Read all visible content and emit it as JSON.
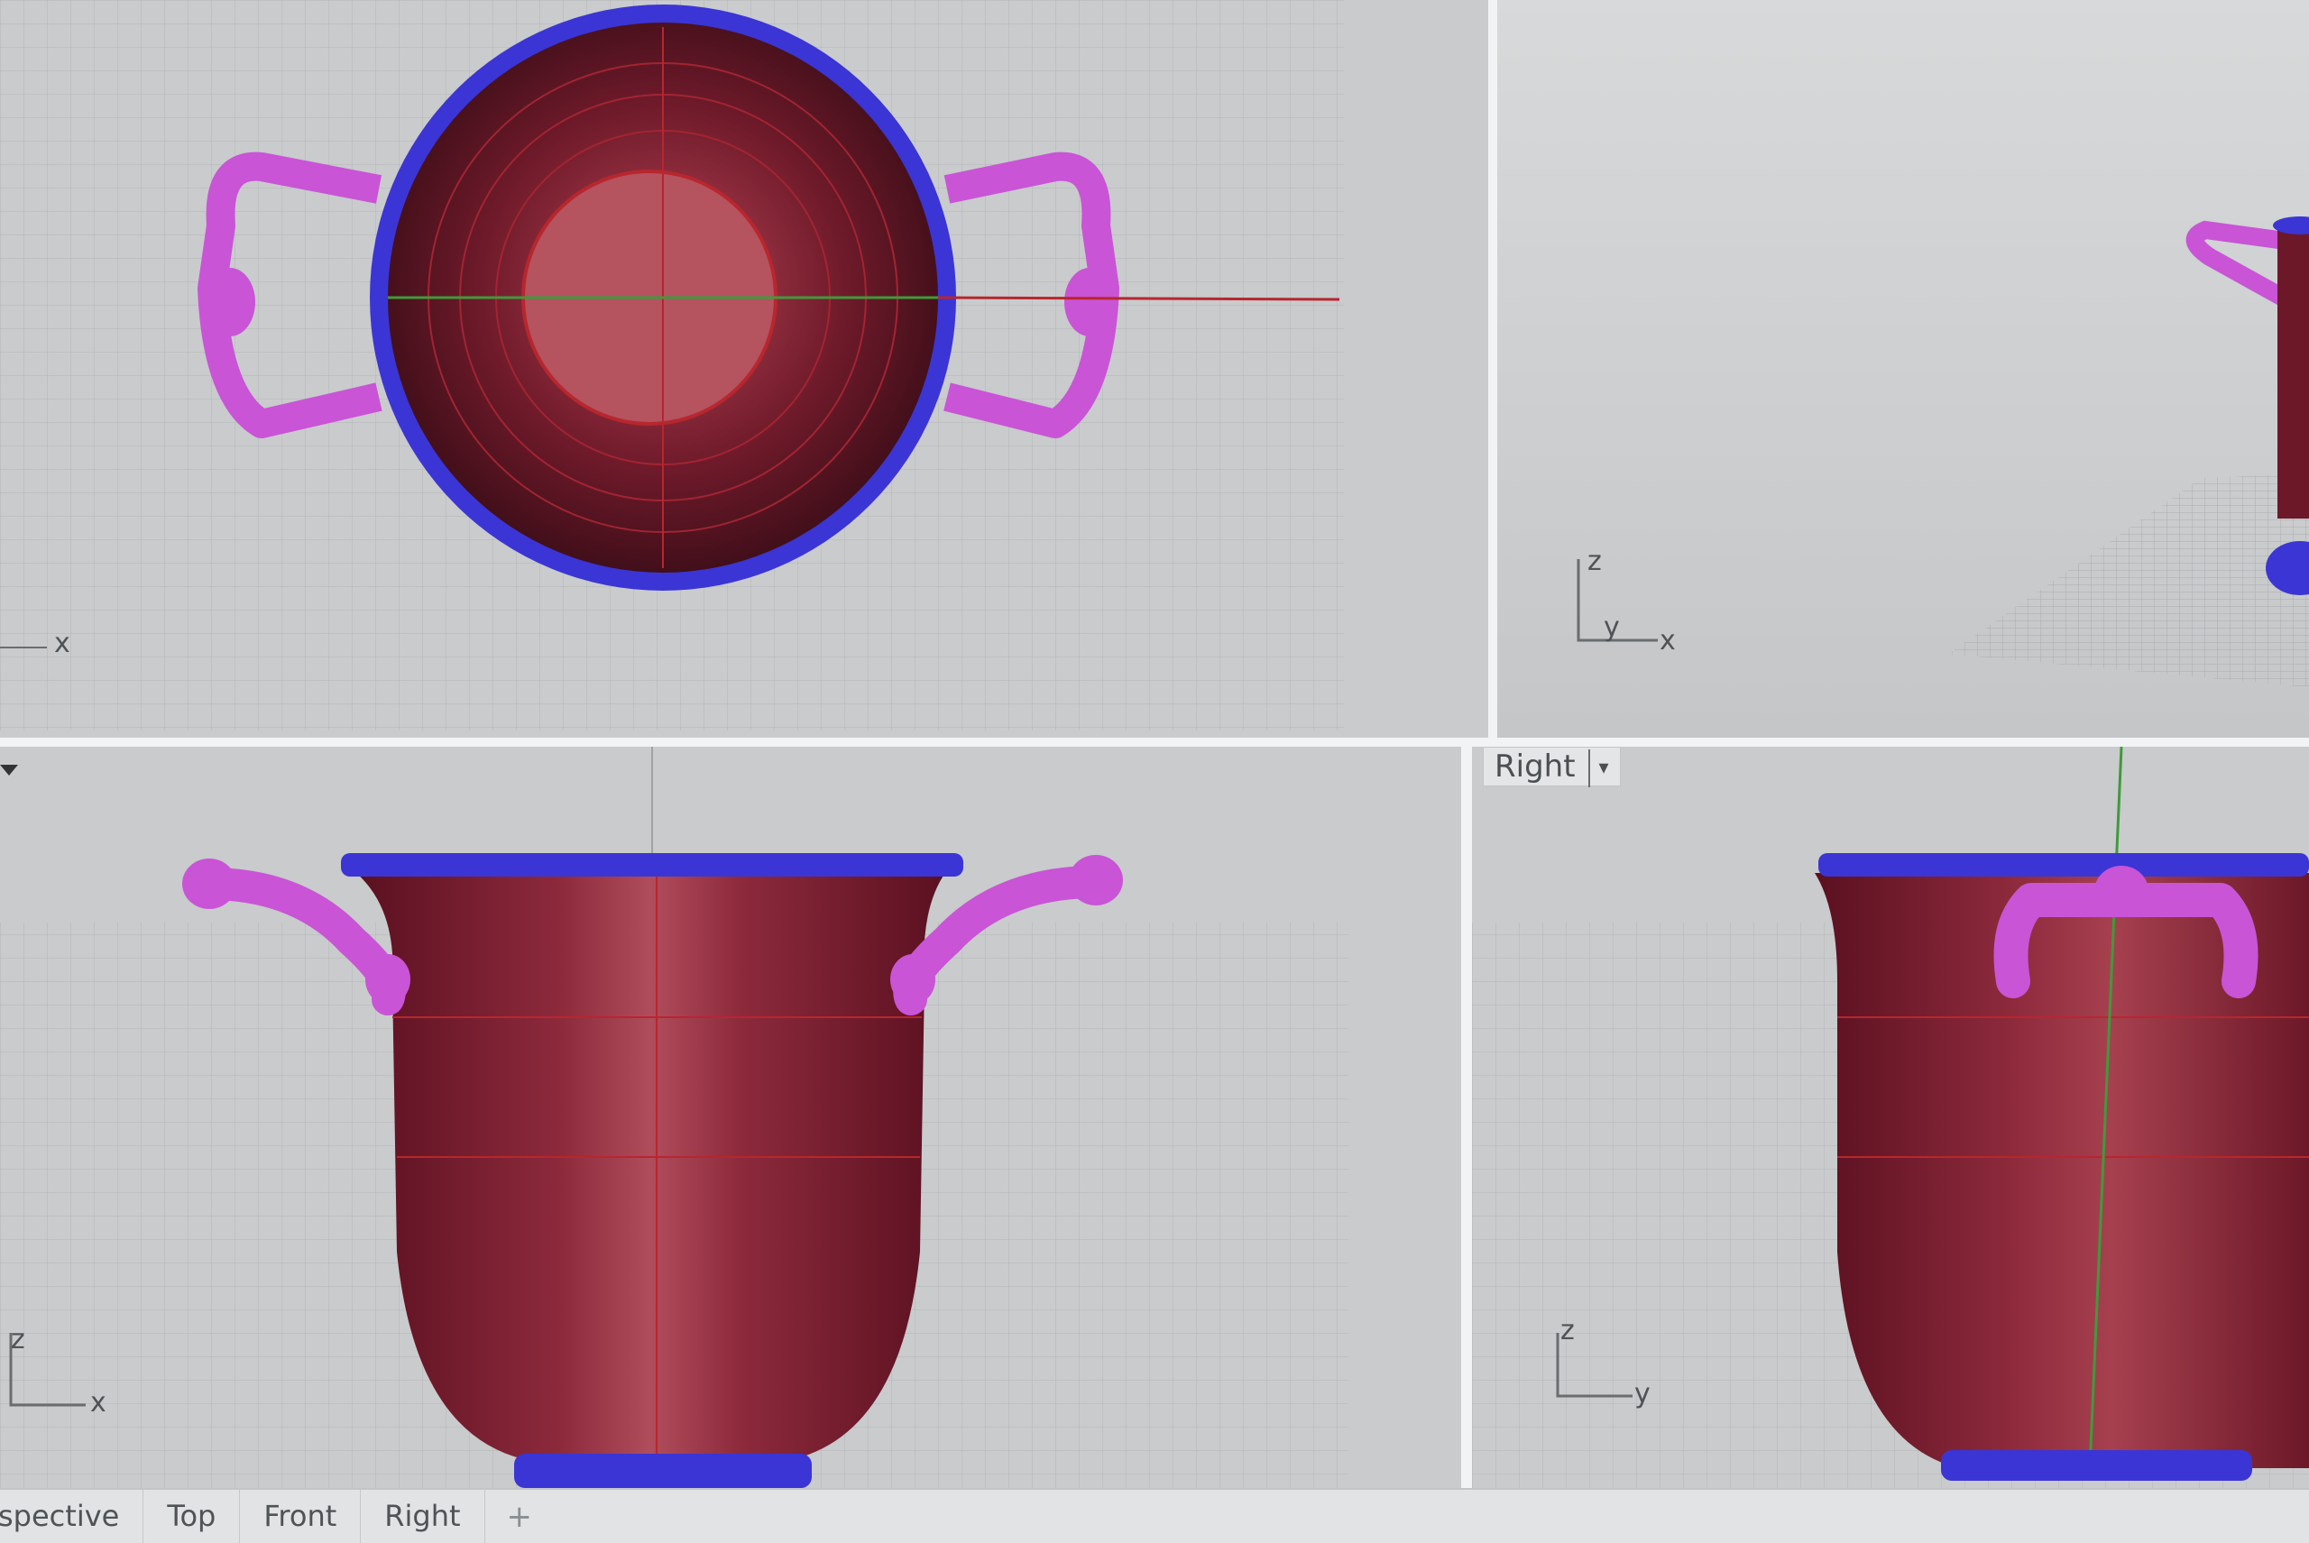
{
  "viewports": {
    "top": {
      "axis_labels": [
        "x"
      ]
    },
    "persp": {
      "axis_labels": [
        "z",
        "y",
        "x"
      ]
    },
    "front": {
      "axis_labels": [
        "z",
        "x"
      ]
    },
    "right": {
      "title": "Right",
      "dropdown": "▾",
      "axis_labels": [
        "z",
        "y"
      ]
    }
  },
  "tabs": [
    "spective",
    "Top",
    "Front",
    "Right"
  ],
  "add_tab": "+",
  "colors": {
    "viewport_bg": "#c9cbcd",
    "grid_line": "#b3b6b8",
    "body_red": "#7a1a2b",
    "rim_blue": "#3b35d6",
    "handle_magenta": "#c954d6",
    "x_axis_red": "#b8262e",
    "y_axis_green": "#3f9a3b"
  },
  "icons": [
    "dropdown-arrow-icon",
    "add-tab-icon"
  ]
}
